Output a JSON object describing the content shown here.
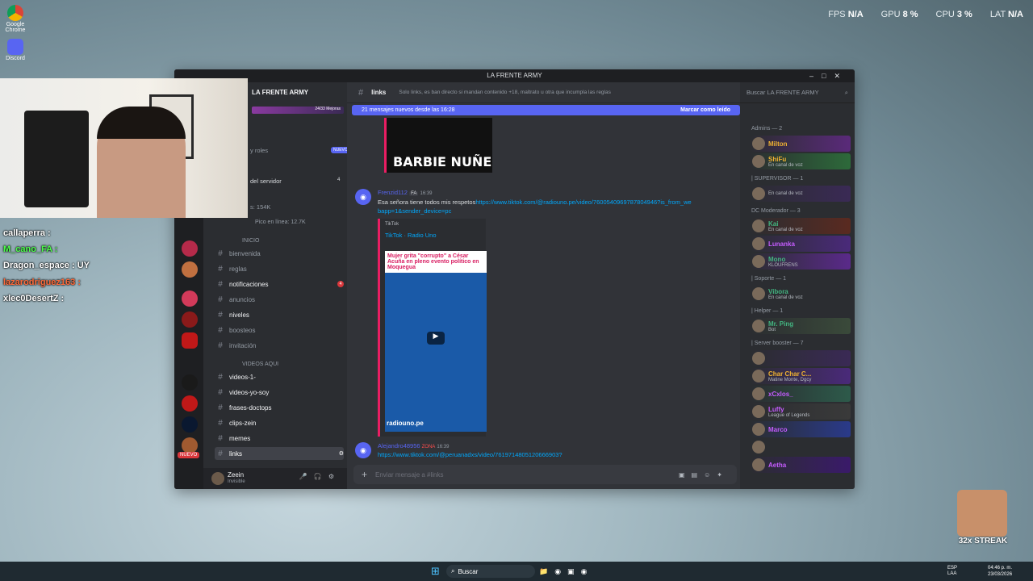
{
  "desktop": {
    "icons": [
      {
        "label": "Google Chrome",
        "color": "#db4437"
      },
      {
        "label": "Discord",
        "color": "#5865f2"
      }
    ]
  },
  "overlay": {
    "fps_label": "FPS",
    "fps_value": "N/A",
    "gpu_label": "GPU",
    "gpu_value": "8 %",
    "cpu_label": "CPU",
    "cpu_value": "3 %",
    "lat_label": "LAT",
    "lat_value": "N/A"
  },
  "stream_chat": [
    {
      "text": "callaperra :",
      "color": "#ffffff"
    },
    {
      "text": "M_cano_FA :",
      "color": "#4cff4c"
    },
    {
      "text": "Dragon_espace : UY",
      "color": "#ffffff"
    },
    {
      "text": "lazarodriguez163 :",
      "color": "#ff6a3a"
    },
    {
      "text": "xlec0DesertZ :",
      "color": "#ffffff"
    }
  ],
  "window": {
    "title": "LA FRENTE ARMY"
  },
  "server": {
    "name": "LA FRENTE ARMY",
    "boost_text": "24/33 Mejoras",
    "nuevo_badge": "NUEVO",
    "menu_items": [
      "y roles",
      "del servidor"
    ],
    "stats": [
      "s: 154K",
      "Pico en línea: 12.7K"
    ],
    "servidor_badge": "4",
    "category_inicio": "INICIO",
    "category_videos": "VIDEOS AQUI",
    "channels": [
      {
        "name": "bienvenida",
        "badge": ""
      },
      {
        "name": "reglas",
        "badge": ""
      },
      {
        "name": "notificaciones",
        "badge": "4"
      },
      {
        "name": "anuncios",
        "badge": ""
      },
      {
        "name": "niveles",
        "badge": ""
      },
      {
        "name": "boosteos",
        "badge": ""
      },
      {
        "name": "invitación",
        "badge": ""
      },
      {
        "name": "videos-1-",
        "badge": ""
      },
      {
        "name": "videos-yo-soy",
        "badge": ""
      },
      {
        "name": "frases-doctops",
        "badge": ""
      },
      {
        "name": "clips-zein",
        "badge": ""
      },
      {
        "name": "memes",
        "badge": ""
      },
      {
        "name": "links",
        "badge": ""
      }
    ],
    "rail_nuevo": "NUEVO",
    "user": {
      "name": "Zeein",
      "status": "Invisible"
    }
  },
  "channel": {
    "name": "links",
    "topic": "Solo links, es ban directo si mandan contenido +18, maltrato u otra que incumpla las reglas",
    "banner_text": "21 mensajes nuevos desde las 16:28",
    "banner_action": "Marcar como leído",
    "messages": [
      {
        "author": "Frenzid112",
        "tag": "FA",
        "time": "16:39",
        "text": "Esa señora tiene todos mis respetos",
        "link": "https://www.tiktok.com/@radiouno.pe/video/7600540969787804946?is_from_webapp=1&sender_device=pc",
        "embed_site": "TikTok",
        "embed_title": "TikTok · Radio Uno",
        "embed_caption": "Mujer grita \"corrupto\" a César Acuña en pleno evento político en Moquegua",
        "embed_footer": "radiouno.pe"
      },
      {
        "author": "Alejandro48956",
        "tag": "ZONA",
        "time": "16:39",
        "link": "https://www.tiktok.com/@peruanadxs/video/7619714805120666903?"
      }
    ],
    "previous_image_caption": "BARBIE NUÑE",
    "input_placeholder": "Enviar mensaje a #links"
  },
  "members": {
    "search_placeholder": "Buscar LA FRENTE ARMY",
    "groups": [
      {
        "role": "Admins — 2",
        "members": [
          {
            "name": "Milton",
            "status": "",
            "color": "#f0b232",
            "bg": "#5a2a7a"
          },
          {
            "name": "ShiFu",
            "status": "En canal de voz",
            "color": "#f0b232",
            "bg": "#2d6a3a"
          }
        ]
      },
      {
        "role": "| SUPERVISOR — 1",
        "members": [
          {
            "name": "",
            "status": "En canal de voz",
            "color": "#ff4444",
            "bg": "#3a2a55"
          }
        ]
      },
      {
        "role": "DC Moderador — 3",
        "members": [
          {
            "name": "Kai",
            "status": "En canal de voz",
            "color": "#43b581",
            "bg": "#5a2a20"
          },
          {
            "name": "Lunanka",
            "status": "",
            "color": "#c55cff",
            "bg": "#4a2a7a"
          },
          {
            "name": "Mono",
            "status": "KLOUFRENS",
            "color": "#43b581",
            "bg": "#5a2a8a"
          }
        ]
      },
      {
        "role": "| Soporte — 1",
        "members": [
          {
            "name": "Vibora",
            "status": "En canal de voz",
            "color": "#43b581",
            "bg": "#2b2d31"
          }
        ]
      },
      {
        "role": "| Helper — 1",
        "members": [
          {
            "name": "Mr. Ping",
            "status": "Bot",
            "color": "#43b581",
            "bg": "#3a4a3a"
          }
        ]
      },
      {
        "role": "| Server booster — 7",
        "members": [
          {
            "name": "",
            "status": "",
            "color": "#ff4444",
            "bg": "#3a2a55"
          },
          {
            "name": "Char Char C...",
            "status": "Matine Monte, Dgcy",
            "color": "#f0b232",
            "bg": "#4a2a7a"
          },
          {
            "name": "xCxlos_",
            "status": "",
            "color": "#c55cff",
            "bg": "#2d5a4a"
          },
          {
            "name": "Luffy",
            "status": "League of Legends",
            "color": "#c55cff",
            "bg": "#3a3a3a"
          },
          {
            "name": "Marco",
            "status": "",
            "color": "#c55cff",
            "bg": "#2a3a8a"
          },
          {
            "name": "",
            "status": "",
            "color": "#b5bac1",
            "bg": "#2b2d31"
          },
          {
            "name": "Aetha",
            "status": "",
            "color": "#c55cff",
            "bg": "#3a1a6a"
          }
        ]
      }
    ]
  },
  "streak": {
    "label": "32x STREAK"
  },
  "taskbar": {
    "search_placeholder": "Buscar",
    "lang": "ESP\nLAA",
    "time": "04:46 p. m.",
    "date": "23/03/2026"
  }
}
